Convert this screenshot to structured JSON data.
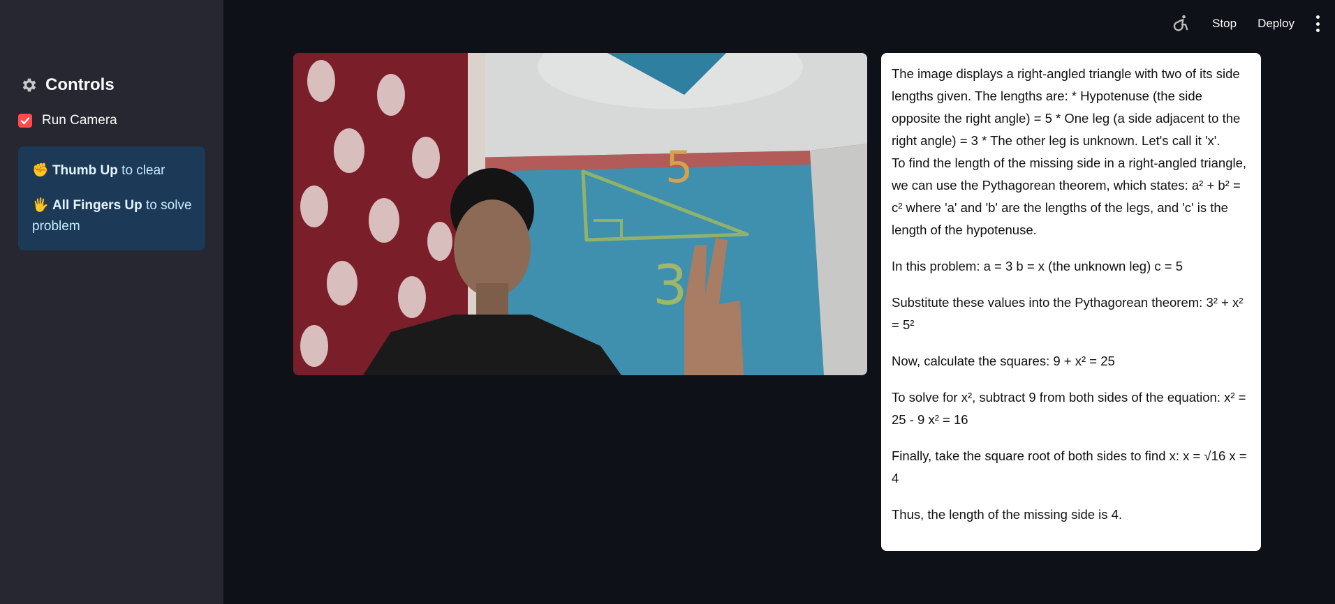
{
  "sidebar": {
    "title": "Controls",
    "title_icon": "gear-icon",
    "checkbox_label": "Run Camera",
    "checkbox_checked": true,
    "accent_color": "#ff4b4b",
    "tips": [
      {
        "emoji": "✊",
        "bold": "Thumb Up",
        "rest": " to clear"
      },
      {
        "emoji": "🖐",
        "bold": "All Fingers Up",
        "rest": " to solve problem"
      }
    ]
  },
  "header": {
    "accessibility_icon": "running-man-icon",
    "stop_label": "Stop",
    "deploy_label": "Deploy",
    "menu_icon": "kebab-menu-icon"
  },
  "camera": {
    "drawn_top_number": "5",
    "drawn_bottom_number": "3"
  },
  "answer": {
    "paragraphs": [
      "The image displays a right-angled triangle with two of its side lengths given. The lengths are: * Hypotenuse (the side opposite the right angle) = 5 * One leg (a side adjacent to the right angle) = 3 * The other leg is unknown. Let's call it 'x'.",
      "To find the length of the missing side in a right-angled triangle, we can use the Pythagorean theorem, which states: a² + b² = c² where 'a' and 'b' are the lengths of the legs, and 'c' is the length of the hypotenuse.",
      "In this problem: a = 3 b = x (the unknown leg) c = 5",
      "Substitute these values into the Pythagorean theorem: 3² + x² = 5²",
      "Now, calculate the squares: 9 + x² = 25",
      "To solve for x², subtract 9 from both sides of the equation: x² = 25 - 9 x² = 16",
      "Finally, take the square root of both sides to find x: x = √16 x = 4",
      "Thus, the length of the missing side is 4."
    ]
  }
}
